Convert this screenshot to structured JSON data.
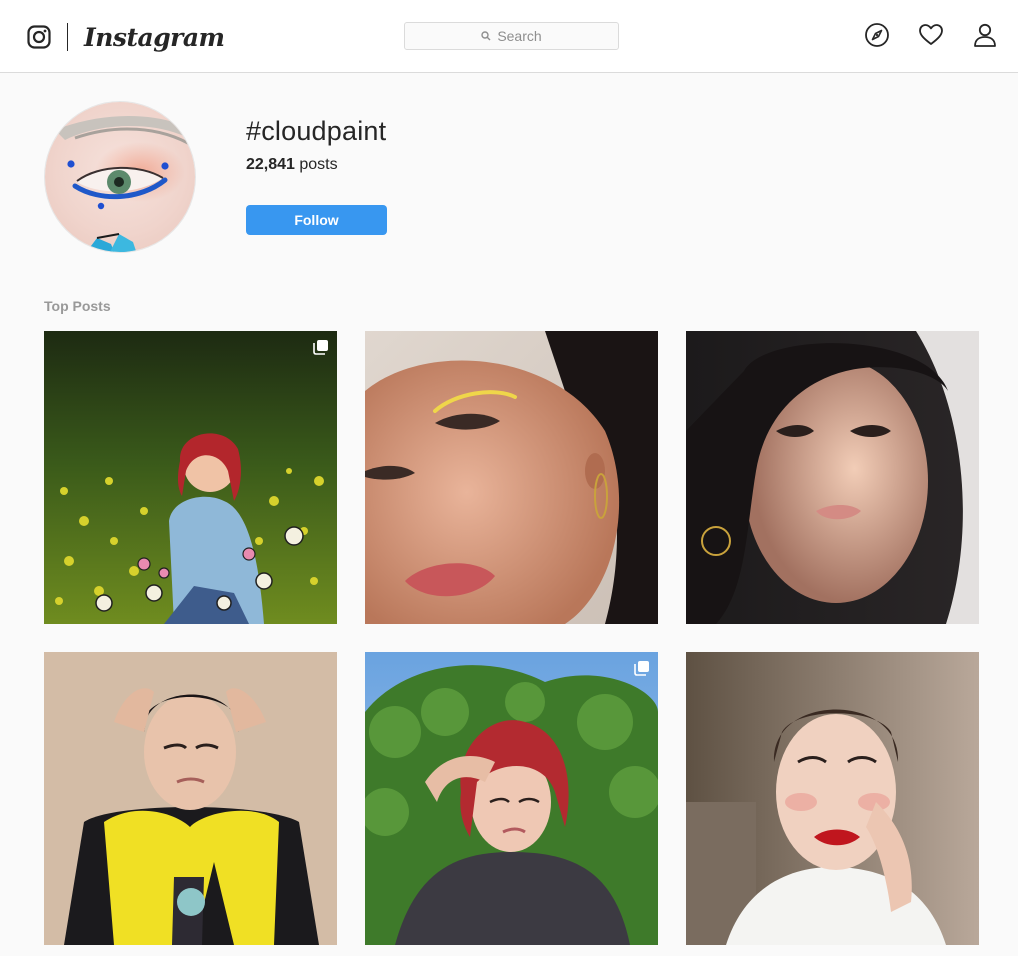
{
  "header": {
    "logo_text": "Instagram",
    "search_placeholder": "Search",
    "icons": [
      "instagram-camera-icon",
      "explore-compass-icon",
      "activity-heart-icon",
      "profile-person-icon"
    ]
  },
  "hashtag": {
    "title": "#cloudpaint",
    "post_count": "22,841",
    "post_count_suffix": " posts",
    "follow_label": "Follow"
  },
  "section": {
    "label": "Top Posts"
  },
  "posts": [
    {
      "description": "red-haired woman in flower field",
      "multi": true
    },
    {
      "description": "close-up face with yellow eyeliner",
      "multi": false
    },
    {
      "description": "woman in sunlit shadow",
      "multi": false
    },
    {
      "description": "woman with yellow scarf",
      "multi": false
    },
    {
      "description": "red-haired woman in garden",
      "multi": true
    },
    {
      "description": "woman with red lipstick",
      "multi": false
    }
  ],
  "colors": {
    "accent": "#3897f0",
    "text": "#262626",
    "muted": "#999999",
    "background": "#fafafa",
    "border": "#dbdbdb"
  }
}
